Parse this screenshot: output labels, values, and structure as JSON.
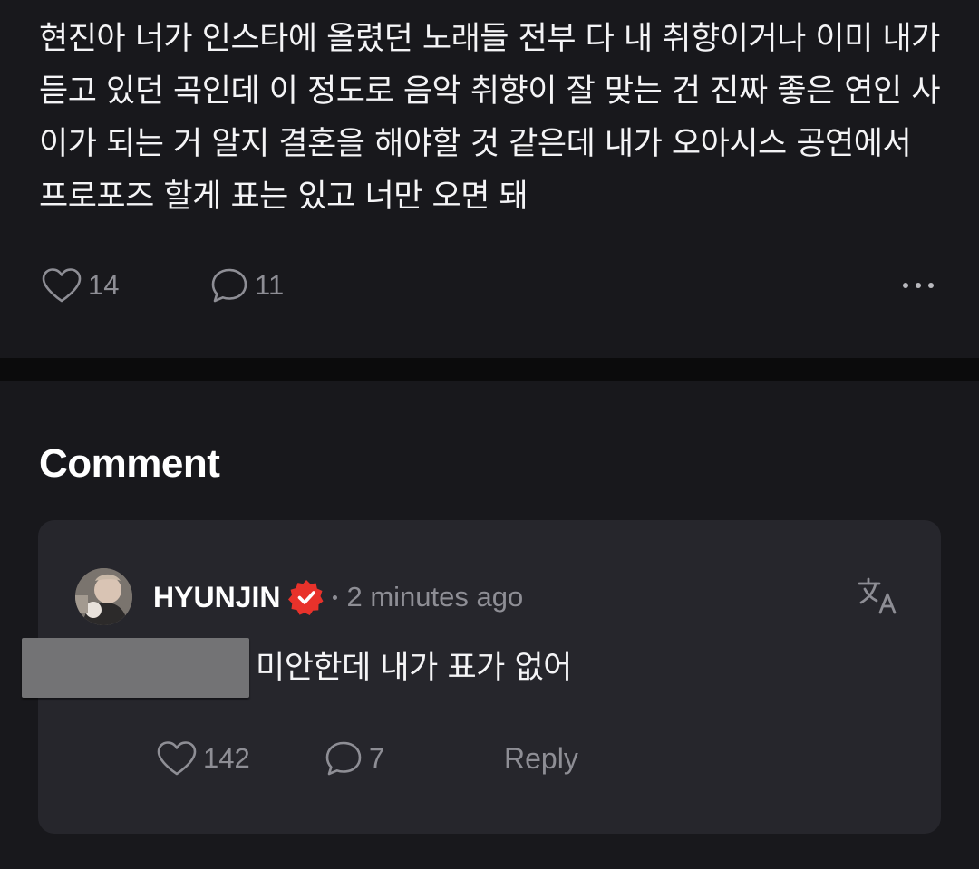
{
  "post": {
    "text": "현진아 너가 인스타에 올렸던 노래들 전부 다 내 취향이거나 이미 내가 듣고 있던 곡인데 이 정도로 음악 취향이 잘 맞는 건 진짜 좋은 연인 사이가 되는 거 알지 결혼을 해야할 것 같은데 내가 오아시스 공연에서 프로포즈 할게 표는 있고 너만 오면 돼",
    "like_count": "14",
    "comment_count": "11"
  },
  "comments_section": {
    "title": "Comment"
  },
  "comment": {
    "username": "HYUNJIN",
    "timestamp": "2 minutes ago",
    "text": "미안한데 내가 표가 없어",
    "like_count": "142",
    "reply_count": "7",
    "reply_label": "Reply"
  },
  "colors": {
    "background": "#111113",
    "card": "#18181c",
    "comment_card": "#26262c",
    "muted_text": "#8e8e95",
    "verified_badge": "#e8322b"
  },
  "icons": {
    "like": "heart-outline-icon",
    "comment": "speech-bubble-icon",
    "more": "ellipsis-icon",
    "verified": "verified-badge-icon",
    "translate": "translate-icon"
  }
}
